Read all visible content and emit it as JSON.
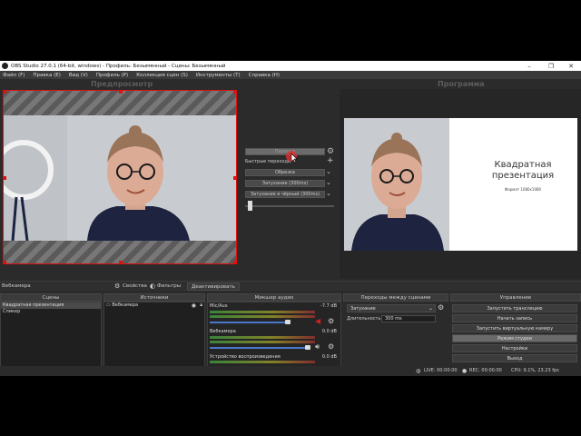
{
  "window": {
    "title": "OBS Studio 27.0.1 (64-bit, windows) - Профиль: Безымянный - Сцены: Безымянный"
  },
  "window_controls": [
    "–",
    "❐",
    "✕"
  ],
  "menu": [
    "Файл (F)",
    "Правка (E)",
    "Вид (V)",
    "Профиль (P)",
    "Коллекция сцен (S)",
    "Инструменты (T)",
    "Справка (H)"
  ],
  "preview": {
    "label": "Предпросмотр"
  },
  "program": {
    "label": "Программа",
    "slide_title": "Квадратная презентация",
    "slide_subtitle": "Формат 1080х1080"
  },
  "transitions_panel": {
    "transition_button": "Переход",
    "quick_label": "Быстрые переходы",
    "cut": "Обрезка",
    "fade": "Затухание (300ms)",
    "fade_black": "Затухание в чёрный (300ms)",
    "tbar_level": 0.03
  },
  "source_bar": {
    "name": "Вебкамера",
    "properties": "Свойства",
    "filters": "Фильтры",
    "deactivate": "Деактивировать"
  },
  "scenes": {
    "header": "Сцены",
    "items": [
      "Квадратная презентация",
      "Спикер"
    ],
    "selected": 0
  },
  "sources": {
    "header": "Источники",
    "items": [
      "Вебкамера"
    ]
  },
  "mixer": {
    "header": "Микшер аудио",
    "channels": [
      {
        "name": "Mic/Aux",
        "db": "-7.7 dB",
        "volume": 0.8
      },
      {
        "name": "Вебкамера",
        "db": "0.0 dB",
        "volume": 1.0
      },
      {
        "name": "Устройство воспроизведения",
        "db": "0.0 dB",
        "volume": 1.0
      }
    ]
  },
  "transitions_dock": {
    "header": "Переходы между сценами",
    "current": "Затухание",
    "duration_label": "Длительность",
    "duration_value": "300 ms"
  },
  "controls": {
    "header": "Управление",
    "buttons": [
      "Запустить трансляцию",
      "Начать запись",
      "Запустить виртуальную камеру",
      "Режим студии",
      "Настройки",
      "Выход"
    ],
    "active": 3
  },
  "status": {
    "live": "LIVE: 00:00:00",
    "rec": "REC: 00:00:00",
    "cpu": "CPU: 9.1%, 23.23 fps"
  },
  "colors": {
    "selection_red": "#e01010",
    "recording_cursor": "#e03030",
    "volume_blue": "#4b77c8"
  }
}
